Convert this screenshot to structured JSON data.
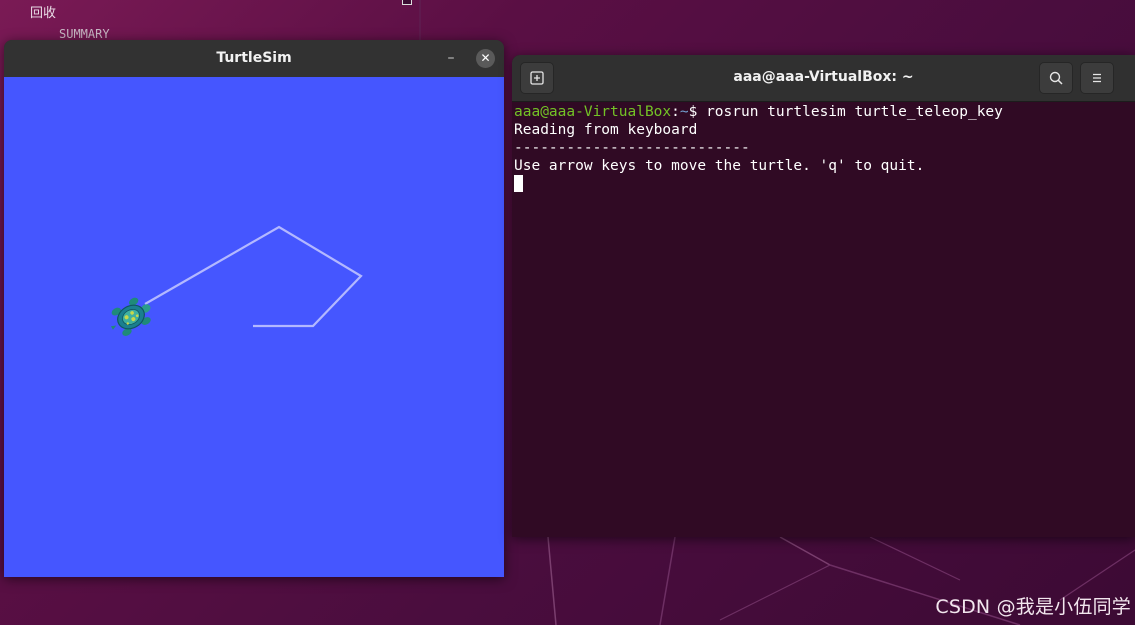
{
  "desktop": {
    "top_label": "回收",
    "summary_label": "SUMMARY",
    "watermark": "CSDN @我是小伍同学"
  },
  "turtlesim": {
    "title": "TurtleSim",
    "minimize_glyph": "–",
    "close_glyph": "✕",
    "background_color": "#4556ff",
    "pen_color": "#b3b8ff",
    "icons": [
      "turtle-icon"
    ]
  },
  "terminal": {
    "title": "aaa@aaa-VirtualBox: ~",
    "new_tab_glyph": "⊞",
    "search_glyph": "⌕",
    "menu_glyph": "≡",
    "prompt_user": "aaa@aaa-VirtualBox",
    "prompt_sep": ":",
    "prompt_path": "~",
    "prompt_symbol": "$ ",
    "command": "rosrun turtlesim turtle_teleop_key",
    "output": [
      "Reading from keyboard",
      "---------------------------",
      "Use arrow keys to move the turtle. 'q' to quit."
    ],
    "background_color": "#300a24"
  }
}
